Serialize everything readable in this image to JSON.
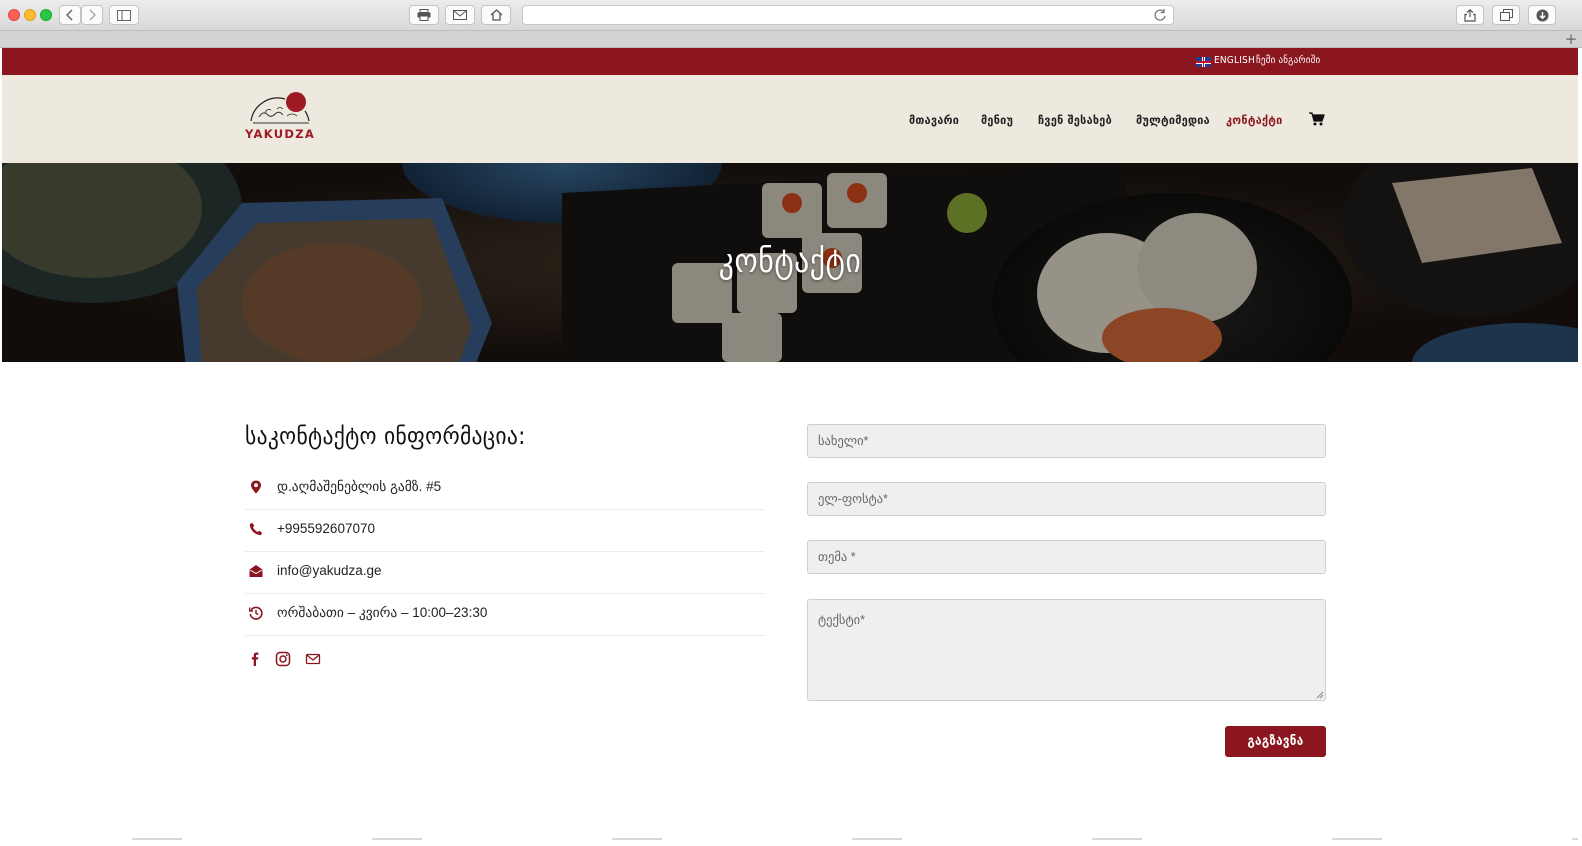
{
  "browser": {
    "address": ""
  },
  "topbar": {
    "language": "ENGLISH",
    "account": "ჩემი ანგარიში"
  },
  "nav": {
    "items": [
      {
        "label": "მთავარი"
      },
      {
        "label": "მენიუ"
      },
      {
        "label": "ჩვენ შესახებ"
      },
      {
        "label": "მულტიმედია"
      },
      {
        "label": "კონტაქტი",
        "active": true
      }
    ]
  },
  "logo": {
    "text": "YAKUDZA"
  },
  "hero": {
    "title": "კონტაქტი"
  },
  "contact": {
    "heading": "საკონტაქტო ინფორმაცია:",
    "address": "დ.აღმაშენებლის გამზ. #5",
    "phone": "+995592607070",
    "email": "info@yakudza.ge",
    "hours": "ორშაბათი – კვირა – 10:00–23:30"
  },
  "form": {
    "name_placeholder": "სახელი*",
    "email_placeholder": "ელ-ფოსტა*",
    "subject_placeholder": "თემა *",
    "message_placeholder": "ტექსტი*",
    "send_label": "გაგზავნა"
  },
  "colors": {
    "brand": "#8b1620",
    "header_bg": "#ede9df",
    "field_bg": "#efefef"
  }
}
